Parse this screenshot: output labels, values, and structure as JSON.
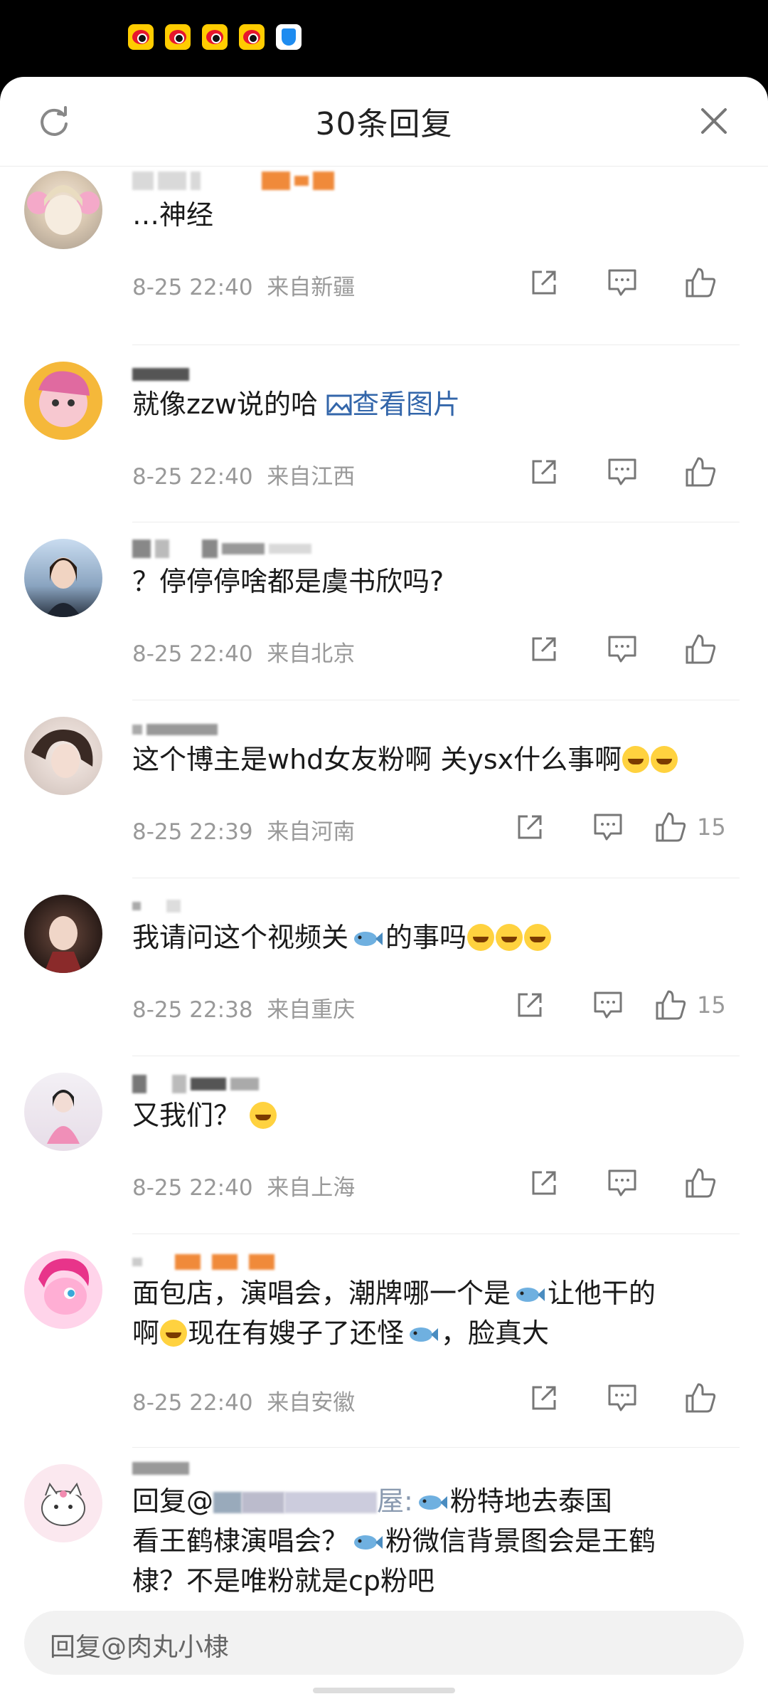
{
  "header": {
    "title": "30条回复",
    "refresh_icon": "refresh-icon",
    "close_icon": "close-icon"
  },
  "status_bar": {
    "icons": [
      "weibo-icon",
      "weibo-icon",
      "weibo-icon",
      "weibo-icon",
      "shield-icon"
    ]
  },
  "comments": [
    {
      "text": "…神经",
      "time": "8-25 22:40",
      "location": "来自新疆",
      "likes": ""
    },
    {
      "text": "就像zzw说的哈 ",
      "link": "查看图片",
      "time": "8-25 22:40",
      "location": "来自江西",
      "likes": ""
    },
    {
      "text": "？停停停啥都是虞书欣吗?",
      "time": "8-25 22:40",
      "location": "来自北京",
      "likes": ""
    },
    {
      "text": "这个博主是whd女友粉啊 关ysx什么事啊",
      "time": "8-25 22:39",
      "location": "来自河南",
      "likes": "15"
    },
    {
      "text_a": "我请问这个视频关",
      "text_b": "的事吗",
      "time": "8-25 22:38",
      "location": "来自重庆",
      "likes": "15"
    },
    {
      "text": "又我们？",
      "time": "8-25 22:40",
      "location": "来自上海",
      "likes": ""
    },
    {
      "line1_a": "面包店，演唱会，潮牌哪一个是",
      "line1_b": "让他干的",
      "line2_a": "啊",
      "line2_b": "现在有嫂子了还怪",
      "line2_c": "，脸真大",
      "time": "8-25 22:40",
      "location": "来自安徽",
      "likes": ""
    },
    {
      "username_fragment": "",
      "prefix": "回复@",
      "mention_tail": "屋:",
      "line1_tail": "粉特地去泰国",
      "line2_a": "看王鹤棣演唱会？",
      "line2_b": "粉微信背景图会是王鹤",
      "line3": "棣？不是唯粉就是cp粉吧"
    }
  ],
  "reply_bar": {
    "placeholder": "回复@肉丸小棣"
  }
}
